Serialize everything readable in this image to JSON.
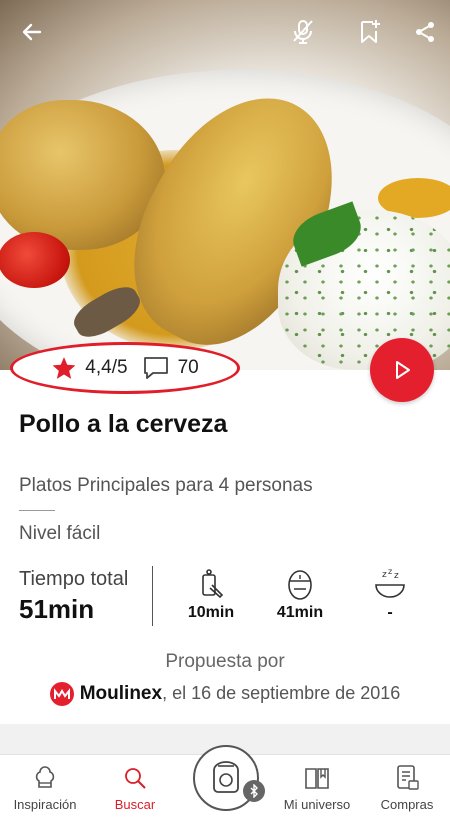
{
  "recipe": {
    "rating": "4,4/5",
    "comments": "70",
    "title": "Pollo a la cerveza",
    "category": "Platos Principales para 4 personas",
    "level": "Nivel fácil",
    "total_time_label": "Tiempo total",
    "total_time_value": "51min",
    "prep_time": "10min",
    "cook_time": "41min",
    "rest_time": "-",
    "proposed_by": "Propuesta por",
    "brand": "Moulinex",
    "date": ", el 16 de septiembre de 2016"
  },
  "nav": {
    "items": [
      {
        "label": "Inspiración",
        "icon": "chef-hat-icon"
      },
      {
        "label": "Buscar",
        "icon": "search-icon"
      },
      {
        "label": "Mi universo",
        "icon": "book-icon"
      },
      {
        "label": "Compras",
        "icon": "shopping-list-icon"
      }
    ],
    "active": "Buscar"
  },
  "colors": {
    "accent": "#e5202e",
    "rating_outline": "#e11d2a",
    "text_dark": "#111111",
    "text_muted": "#555555"
  }
}
